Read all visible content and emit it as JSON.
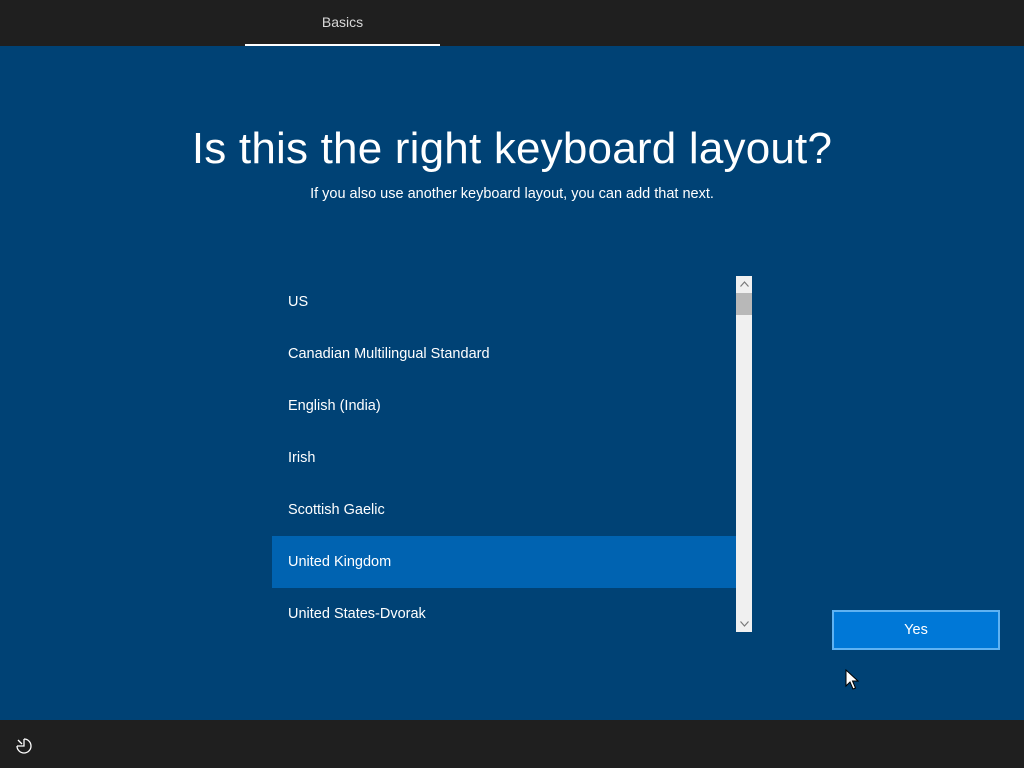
{
  "header": {
    "tabs": [
      {
        "label": "Basics",
        "active": true
      }
    ]
  },
  "main": {
    "title": "Is this the right keyboard layout?",
    "subtitle": "If you also use another keyboard layout, you can add that next.",
    "layouts": [
      {
        "label": "US",
        "selected": false
      },
      {
        "label": "Canadian Multilingual Standard",
        "selected": false
      },
      {
        "label": "English (India)",
        "selected": false
      },
      {
        "label": "Irish",
        "selected": false
      },
      {
        "label": "Scottish Gaelic",
        "selected": false
      },
      {
        "label": "United Kingdom",
        "selected": true
      },
      {
        "label": "United States-Dvorak",
        "selected": false
      }
    ],
    "yes_label": "Yes"
  },
  "footer": {
    "ease_of_access_icon": "ease-of-access-icon"
  },
  "colors": {
    "background": "#004275",
    "bars": "#1f1f1f",
    "selected_item": "#0063b1",
    "accent_button": "#0078d7"
  }
}
